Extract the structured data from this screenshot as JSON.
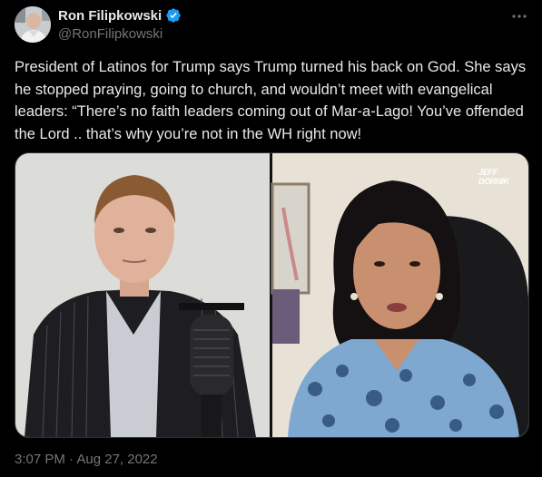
{
  "tweet": {
    "author": {
      "display_name": "Ron Filipkowski",
      "handle": "@RonFilipkowski",
      "avatar": "profile-photo",
      "verified": true
    },
    "text": "President of Latinos for Trump says Trump turned his back on God. She says he stopped praying, going to church, and wouldn’t meet with evangelical leaders: “There’s no faith leaders coming out of Mar-a-Lago! You’ve offended the Lord .. that’s why you’re not in the WH right now!",
    "media": {
      "type": "video-still",
      "watermark": "JEFF DORNIK"
    },
    "timestamp": "3:07 PM · Aug 27, 2022"
  },
  "colors": {
    "background": "#000000",
    "text_primary": "#e7e9ea",
    "text_secondary": "#71767b",
    "verified_badge": "#1d9bf0",
    "border": "#2f3336"
  },
  "icons": {
    "verified": "verified-badge-icon",
    "more": "more-options-icon"
  }
}
